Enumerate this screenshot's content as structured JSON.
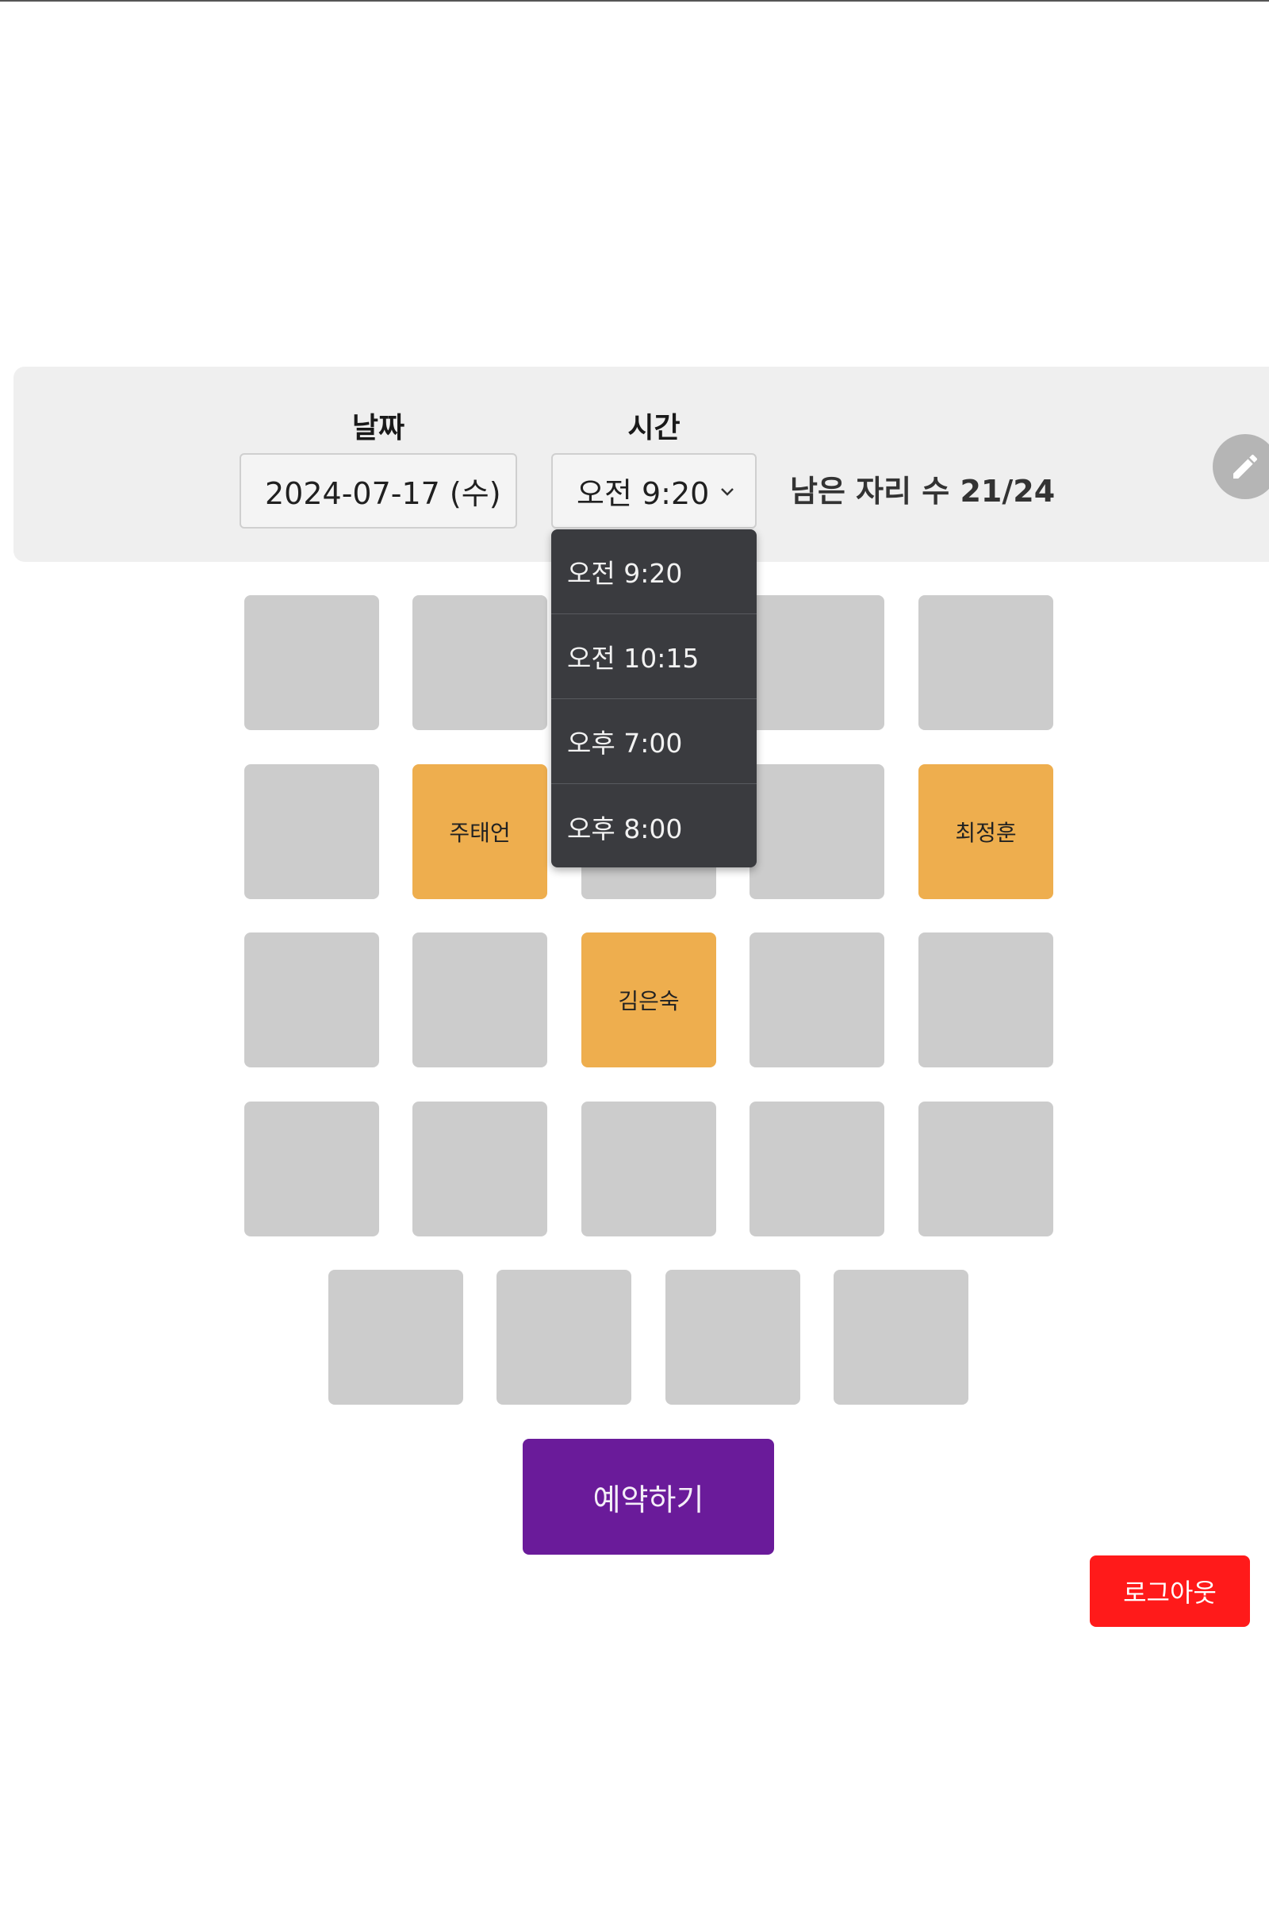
{
  "filters": {
    "date_label": "날짜",
    "date_value": "2024-07-17 (수)",
    "time_label": "시간",
    "time_value": "오전 9:20",
    "remaining_text": "남은 자리 수 21/24"
  },
  "time_options": [
    "오전 9:20",
    "오전 10:15",
    "오후 7:00",
    "오후 8:00"
  ],
  "seats": {
    "rows": [
      [
        "",
        "",
        "",
        "",
        ""
      ],
      [
        "",
        "주태언",
        "",
        "",
        "최정훈"
      ],
      [
        "",
        "",
        "김은숙",
        "",
        ""
      ],
      [
        "",
        "",
        "",
        "",
        ""
      ],
      [
        "",
        "",
        "",
        ""
      ]
    ]
  },
  "actions": {
    "reserve_label": "예약하기",
    "logout_label": "로그아웃"
  },
  "colors": {
    "available_seat": "#cccccc",
    "taken_seat": "#eeae4e",
    "reserve_button": "#6a1b9a",
    "logout_button": "#ff1a1a",
    "dropdown_bg": "#3a3b3f"
  },
  "icons": [
    "chevron-down-icon",
    "pencil-icon"
  ]
}
